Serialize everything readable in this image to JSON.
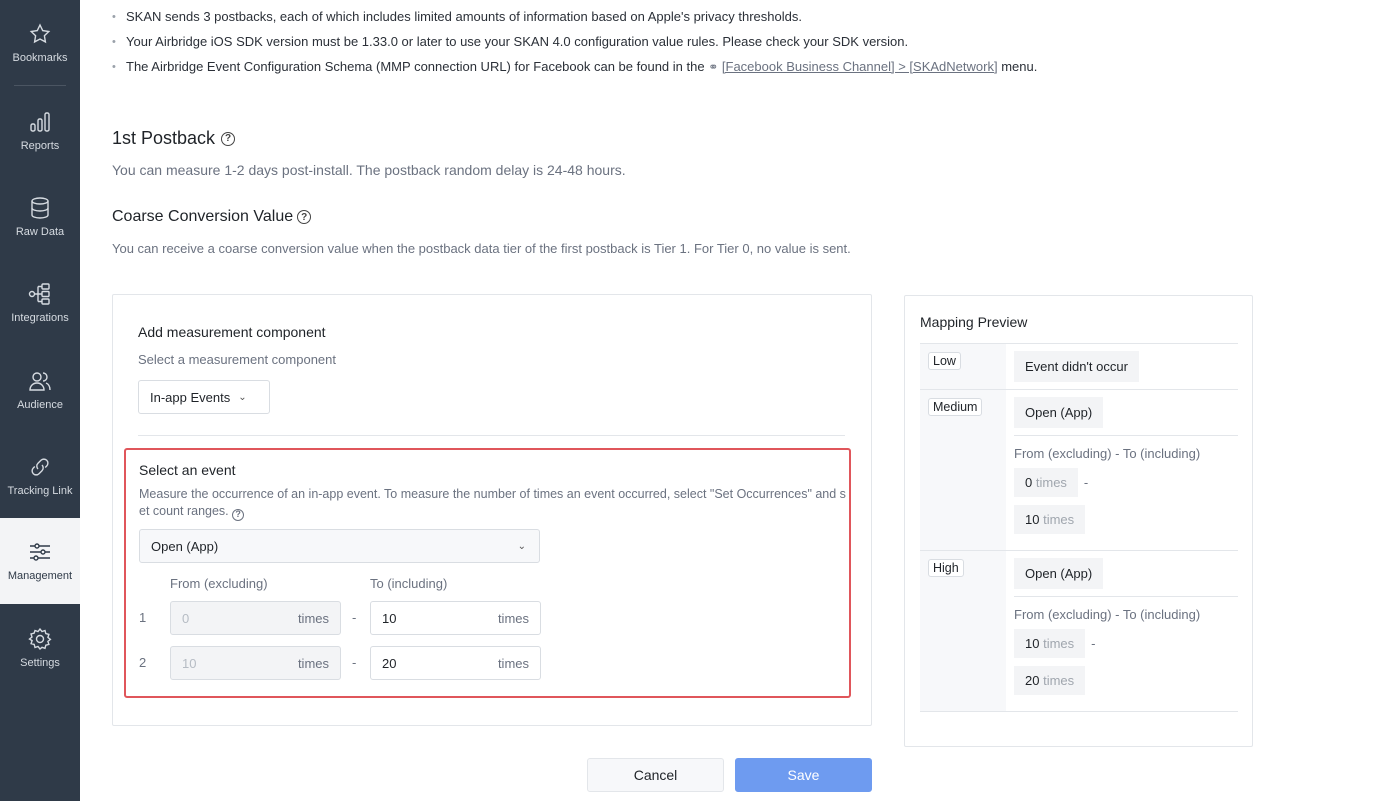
{
  "sidebar": {
    "items": [
      {
        "label": "Bookmarks",
        "icon": "star-icon"
      },
      {
        "label": "Reports",
        "icon": "bar-chart-icon"
      },
      {
        "label": "Raw Data",
        "icon": "database-icon"
      },
      {
        "label": "Integrations",
        "icon": "integrations-icon"
      },
      {
        "label": "Audience",
        "icon": "users-icon"
      },
      {
        "label": "Tracking Link",
        "icon": "link-icon"
      },
      {
        "label": "Management",
        "icon": "sliders-icon"
      },
      {
        "label": "Settings",
        "icon": "gear-icon"
      }
    ],
    "active": "Management"
  },
  "notes": {
    "b1": "SKAN sends 3 postbacks, each of which includes limited amounts of information based on Apple's privacy thresholds.",
    "b2": "Your Airbridge iOS SDK version must be 1.33.0 or later to use your SKAN 4.0 configuration value rules. Please check your SDK version.",
    "b3_pre": "The Airbridge Event Configuration Schema (MMP connection URL) for Facebook can be found in the",
    "b3_link": "[Facebook Business Channel] > [SKAdNetwork]",
    "b3_post": "menu."
  },
  "postback": {
    "title": "1st Postback",
    "desc": "You can measure 1-2 days post-install. The postback random delay is 24-48 hours."
  },
  "coarse": {
    "title": "Coarse Conversion Value",
    "desc": "You can receive a coarse conversion value when the postback data tier of the first postback is Tier 1. For Tier 0, no value is sent."
  },
  "component": {
    "title": "Add measurement component",
    "desc": "Select a measurement component",
    "selected": "In-app Events"
  },
  "event": {
    "title": "Select an event",
    "desc": "Measure the occurrence of an in-app event. To measure the number of times an event occurred, select \"Set Occurrences\" and set count ranges.",
    "selected": "Open (App)",
    "from_label": "From (excluding)",
    "to_label": "To (including)",
    "unit": "times",
    "rows": [
      {
        "num": "1",
        "from": "0",
        "to": "10"
      },
      {
        "num": "2",
        "from": "10",
        "to": "20"
      }
    ]
  },
  "mapping": {
    "title": "Mapping Preview",
    "range_label": "From (excluding) - To (including)",
    "unit": "times",
    "tiers": [
      {
        "tier": "Low",
        "value": "Event didn't occur"
      },
      {
        "tier": "Medium",
        "value": "Open (App)",
        "from": "0",
        "to": "10"
      },
      {
        "tier": "High",
        "value": "Open (App)",
        "from": "10",
        "to": "20"
      }
    ]
  },
  "footer": {
    "cancel": "Cancel",
    "save": "Save"
  },
  "colors": {
    "sidebar_bg": "#2f3a48",
    "highlight_border": "#e0565b",
    "save_button": "#6e9bf0"
  }
}
